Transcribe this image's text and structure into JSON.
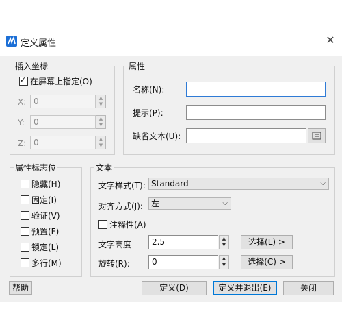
{
  "window": {
    "title": "定义属性"
  },
  "insert_point": {
    "legend": "插入坐标",
    "on_screen_label": "在屏幕上指定(O)",
    "on_screen_checked": true,
    "x_label": "X:",
    "x_value": "0",
    "y_label": "Y:",
    "y_value": "0",
    "z_label": "Z:",
    "z_value": "0"
  },
  "attribute": {
    "legend": "属性",
    "tag_label": "名称(N):",
    "tag_value": "",
    "prompt_label": "提示(P):",
    "prompt_value": "",
    "default_label": "缺省文本(U):",
    "default_value": ""
  },
  "flags": {
    "legend": "属性标志位",
    "items": [
      {
        "label": "隐藏(H)",
        "checked": false
      },
      {
        "label": "固定(I)",
        "checked": false
      },
      {
        "label": "验证(V)",
        "checked": false
      },
      {
        "label": "预置(F)",
        "checked": false
      },
      {
        "label": "锁定(L)",
        "checked": false
      },
      {
        "label": "多行(M)",
        "checked": false
      }
    ]
  },
  "text": {
    "legend": "文本",
    "style_label": "文字样式(T):",
    "style_value": "Standard",
    "justify_label": "对齐方式(J):",
    "justify_value": "左",
    "annotative_label": "注释性(A)",
    "annotative_checked": false,
    "height_label": "文字高度",
    "height_value": "2.5",
    "rotation_label": "旋转(R):",
    "rotation_value": "0",
    "select_height_label": "选择(L) >",
    "select_rotation_label": "选择(C) >"
  },
  "footer": {
    "help_label": "帮助",
    "define_label": "定义(D)",
    "define_exit_label": "定义并退出(E)",
    "close_label": "关闭"
  }
}
